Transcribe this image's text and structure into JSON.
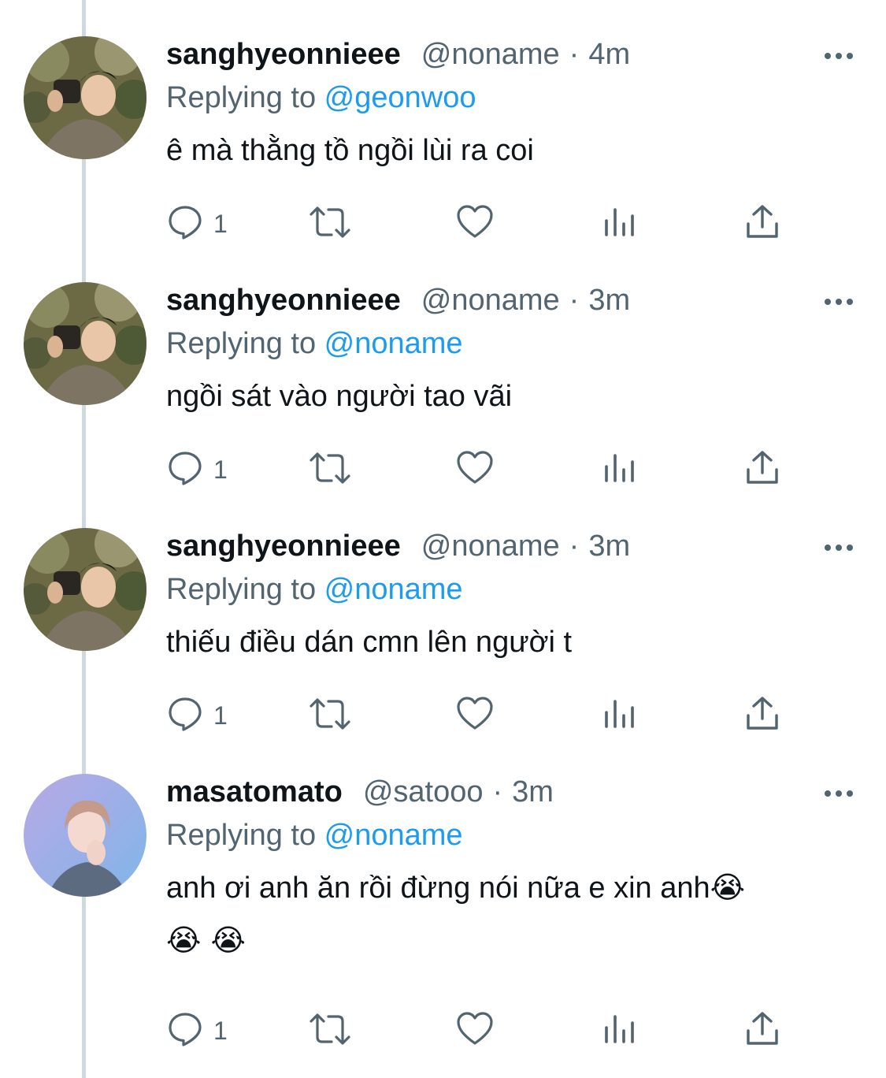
{
  "tweets": [
    {
      "name": "sanghyeonnieee",
      "handle": "@noname",
      "sep": "·",
      "time": "4m",
      "replying_prefix": "Replying to ",
      "replying_to": "@geonwoo",
      "text": "ê mà thằng tồ ngồi lùi ra coi",
      "reply_count": "1",
      "avatar": "portrait-camera"
    },
    {
      "name": "sanghyeonnieee",
      "handle": "@noname",
      "sep": "·",
      "time": "3m",
      "replying_prefix": "Replying to ",
      "replying_to": "@noname",
      "text": "ngồi sát vào người tao vãi",
      "reply_count": "1",
      "avatar": "portrait-camera"
    },
    {
      "name": "sanghyeonnieee",
      "handle": "@noname",
      "sep": "·",
      "time": "3m",
      "replying_prefix": "Replying to ",
      "replying_to": "@noname",
      "text": "thiếu điều dán cmn lên người t",
      "reply_count": "1",
      "avatar": "portrait-camera"
    },
    {
      "name": "masatomato",
      "handle": "@satooo",
      "sep": "·",
      "time": "3m",
      "replying_prefix": "Replying to ",
      "replying_to": "@noname",
      "text": "anh ơi anh ăn rồi đừng nói nữa e xin anh😭",
      "text_line2": "😭 😭",
      "reply_count": "1",
      "avatar": "portrait-purple"
    }
  ],
  "icons": {
    "reply": "reply-icon",
    "retweet": "retweet-icon",
    "like": "heart-icon",
    "views": "views-icon",
    "share": "share-icon",
    "more": "more-icon"
  },
  "colors": {
    "link": "#1d9bf0",
    "secondary": "#536471",
    "thread_line": "#cfd9de"
  }
}
